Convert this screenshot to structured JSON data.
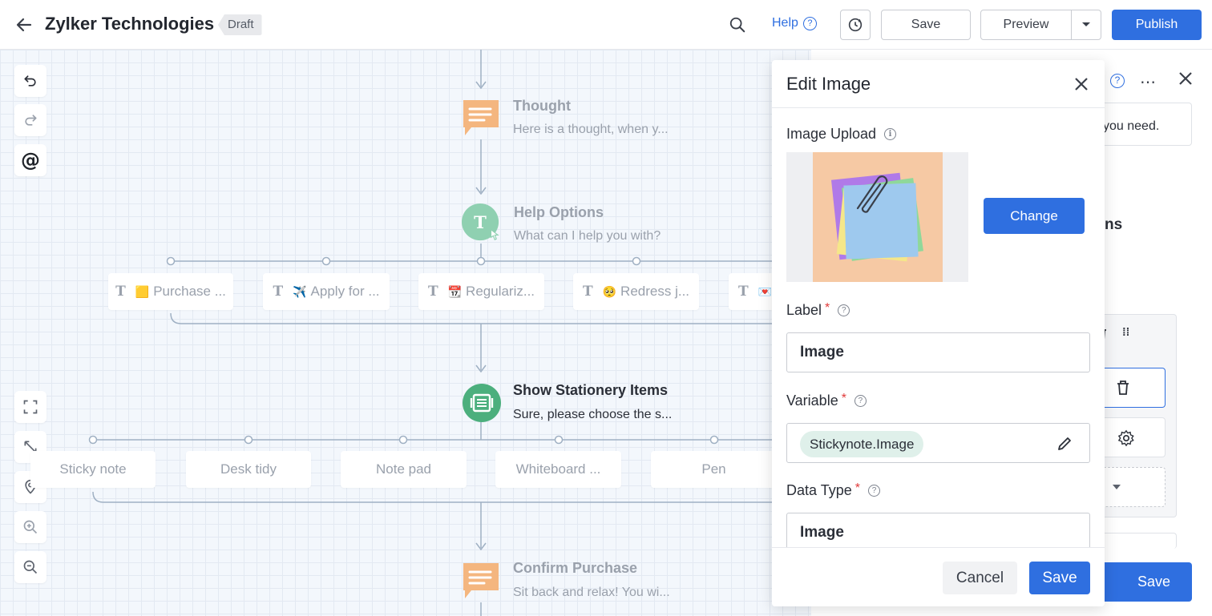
{
  "header": {
    "title": "Zylker Technologies",
    "status_badge": "Draft",
    "help_label": "Help",
    "save_label": "Save",
    "preview_label": "Preview",
    "publish_label": "Publish"
  },
  "flow": {
    "thought": {
      "title": "Thought",
      "subtitle": "Here is a thought, when y..."
    },
    "help_options": {
      "title": "Help Options",
      "subtitle": "What can I help you with?",
      "options": [
        {
          "emoji": "🟨",
          "label": "Purchase ..."
        },
        {
          "emoji": "✈️",
          "label": "Apply for ..."
        },
        {
          "emoji": "📆",
          "label": "Regulariz..."
        },
        {
          "emoji": "🥺",
          "label": "Redress j..."
        },
        {
          "emoji": "💌",
          "label": ""
        }
      ]
    },
    "show_items": {
      "title": "Show Stationery Items",
      "subtitle": "Sure, please choose the s...",
      "options": [
        "Sticky note",
        "Desk tidy",
        "Note pad",
        "Whiteboard ...",
        "Pen"
      ]
    },
    "confirm": {
      "title": "Confirm Purchase",
      "subtitle": "Sit back and relax! You wi..."
    }
  },
  "backpanel": {
    "text_partial": "you need.",
    "heading_partial": "ns",
    "save_label": "Save"
  },
  "modal": {
    "title": "Edit Image",
    "image_upload_label": "Image Upload",
    "change_label": "Change",
    "label_label": "Label",
    "label_value": "Image",
    "variable_label": "Variable",
    "variable_value": "Stickynote.Image",
    "data_type_label": "Data Type",
    "data_type_value": "Image",
    "cancel_label": "Cancel",
    "save_label": "Save"
  },
  "colors": {
    "accent": "#2f6fe0",
    "thought_orange": "#f4b67f",
    "help_green": "#8fd0b1",
    "node_green": "#4caf7d"
  }
}
